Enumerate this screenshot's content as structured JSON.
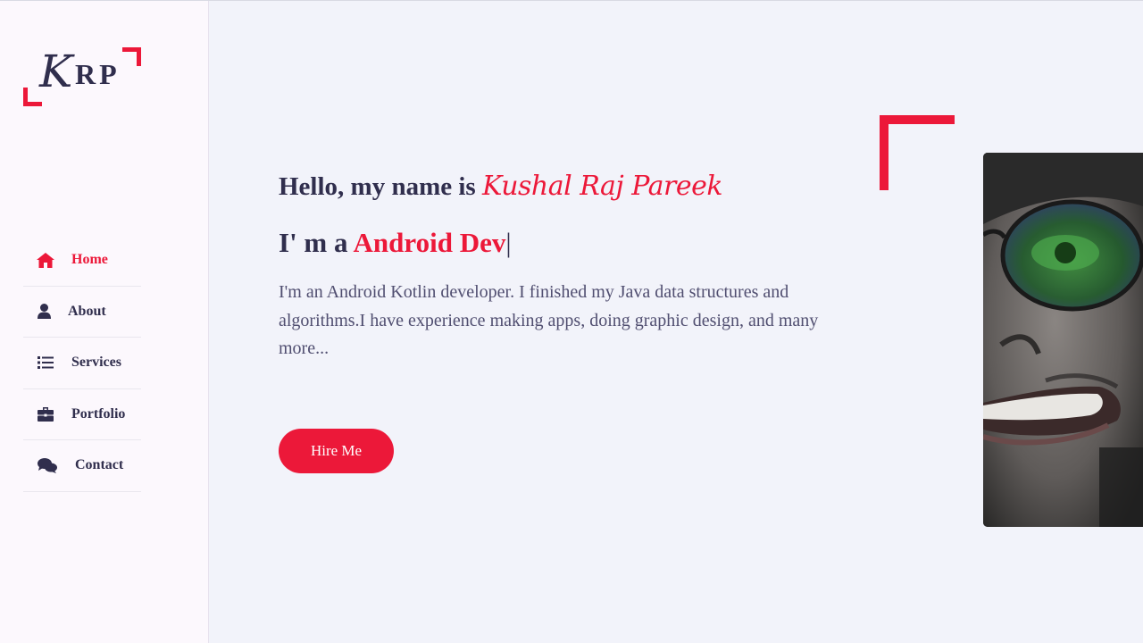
{
  "logo": {
    "letter_k": "K",
    "letters_rp": "RP"
  },
  "nav": {
    "items": [
      {
        "label": "Home",
        "icon": "home-icon",
        "active": true
      },
      {
        "label": "About",
        "icon": "user-icon",
        "active": false
      },
      {
        "label": "Services",
        "icon": "list-icon",
        "active": false
      },
      {
        "label": "Portfolio",
        "icon": "briefcase-icon",
        "active": false
      },
      {
        "label": "Contact",
        "icon": "comments-icon",
        "active": false
      }
    ]
  },
  "hero": {
    "greeting": "Hello, my name is",
    "name": "Kushal Raj Pareek",
    "role_prefix": "I' m a",
    "role": "Android Dev",
    "typing_cursor": "|",
    "description": "I'm an Android Kotlin developer. I finished my Java data structures and algorithms.I have experience making apps, doing graphic design, and many more...",
    "hire_button": "Hire Me"
  },
  "colors": {
    "accent": "#ec1839",
    "text_dark": "#302e4d",
    "text_body": "#504e70",
    "page_bg": "#f2f3fa",
    "sidebar_bg": "#fcf8fd"
  }
}
